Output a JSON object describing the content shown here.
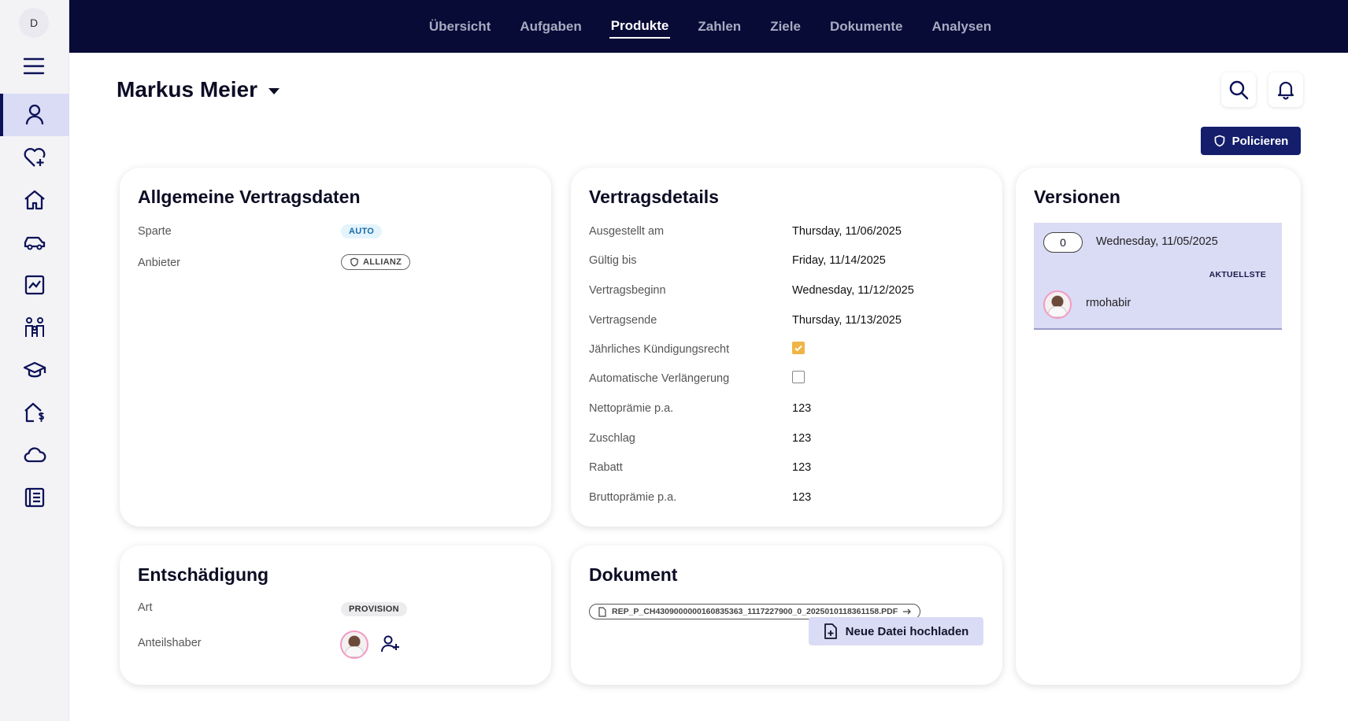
{
  "sidebar": {
    "user_initial": "D",
    "items": [
      {
        "icon": "user-icon",
        "active": true
      },
      {
        "icon": "heart-plus-icon"
      },
      {
        "icon": "home-icon"
      },
      {
        "icon": "car-icon"
      },
      {
        "icon": "chart-line-icon"
      },
      {
        "icon": "family-icon"
      },
      {
        "icon": "graduation-cap-icon"
      },
      {
        "icon": "house-dollar-icon"
      },
      {
        "icon": "cloud-icon"
      },
      {
        "icon": "document-list-icon"
      }
    ]
  },
  "topnav": {
    "tabs": [
      {
        "label": "Übersicht"
      },
      {
        "label": "Aufgaben"
      },
      {
        "label": "Produkte",
        "active": true
      },
      {
        "label": "Zahlen"
      },
      {
        "label": "Ziele"
      },
      {
        "label": "Dokumente"
      },
      {
        "label": "Analysen"
      }
    ]
  },
  "header": {
    "person_name": "Markus Meier",
    "policieren_label": "Policieren"
  },
  "general": {
    "title": "Allgemeine Vertragsdaten",
    "sparte_label": "Sparte",
    "sparte_value": "AUTO",
    "anbieter_label": "Anbieter",
    "anbieter_value": "ALLIANZ"
  },
  "details": {
    "title": "Vertragsdetails",
    "rows": [
      {
        "label": "Ausgestellt am",
        "value": "Thursday, 11/06/2025"
      },
      {
        "label": "Gültig bis",
        "value": "Friday, 11/14/2025"
      },
      {
        "label": "Vertragsbeginn",
        "value": "Wednesday, 11/12/2025"
      },
      {
        "label": "Vertragsende",
        "value": "Thursday, 11/13/2025"
      },
      {
        "label": "Jährliches Kündigungsrecht",
        "checked": true
      },
      {
        "label": "Automatische Verlängerung",
        "checked": false
      },
      {
        "label": "Nettoprämie p.a.",
        "value": "123"
      },
      {
        "label": "Zuschlag",
        "value": "123"
      },
      {
        "label": "Rabatt",
        "value": "123"
      },
      {
        "label": "Bruttoprämie p.a.",
        "value": "123"
      }
    ]
  },
  "versions": {
    "title": "Versionen",
    "number": "0",
    "date": "Wednesday, 11/05/2025",
    "tag": "AKTUELLSTE",
    "user": "rmohabir"
  },
  "compensation": {
    "title": "Entschädigung",
    "art_label": "Art",
    "art_value": "PROVISION",
    "holders_label": "Anteilshaber"
  },
  "document": {
    "title": "Dokument",
    "filename": "REP_P_CH4309000000160835363_1117227900_0_20250101183611​58.PDF",
    "upload_label": "Neue Datei hochladen"
  },
  "colors": {
    "navy": "#070b36",
    "accent": "#141e6b",
    "active_bg": "#dadbf5",
    "checkbox_on": "#f0b545"
  }
}
